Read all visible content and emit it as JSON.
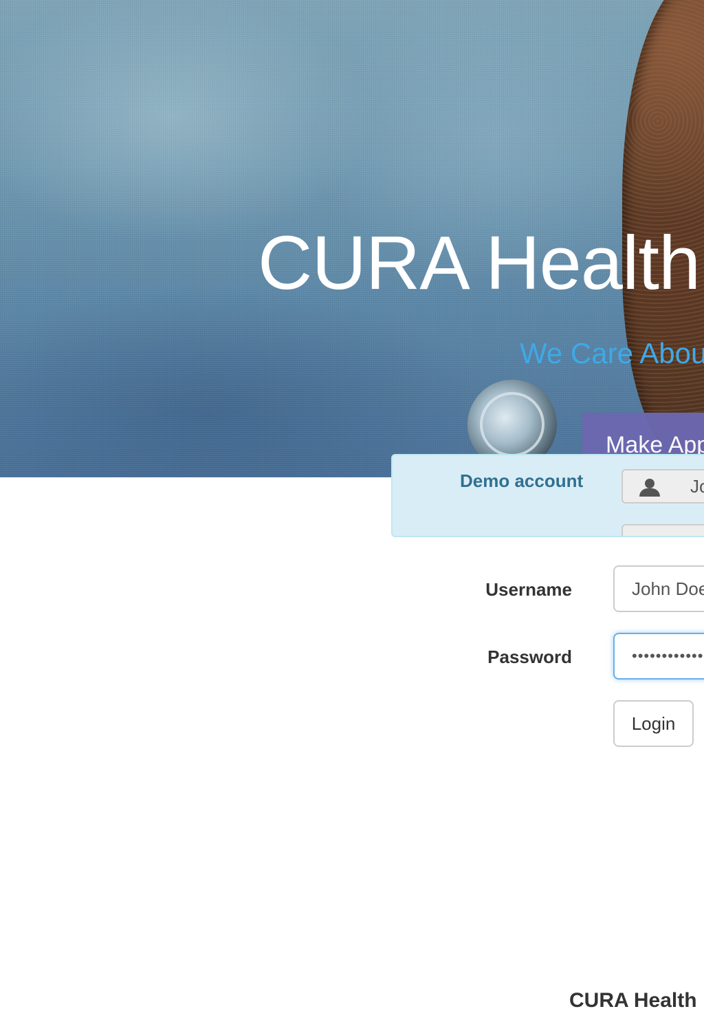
{
  "hero": {
    "title": "CURA Health",
    "subtitle": "We Care Abou",
    "make_appointment_label": "Make App"
  },
  "demo_account": {
    "label": "Demo account",
    "username_value": "Jo",
    "password_value": "",
    "user_icon": "user-icon"
  },
  "login_form": {
    "username_label": "Username",
    "username_value": "John Doe",
    "password_label": "Password",
    "password_value": "••••••••••••",
    "login_label": "Login"
  },
  "footer": {
    "brand": "CURA Health"
  },
  "colors": {
    "subtitle": "#3fa9e6",
    "appointment_button": "#6c68b0",
    "alert_background": "#d9edf7",
    "alert_text": "#31708f",
    "focus_border": "#66afe9"
  }
}
